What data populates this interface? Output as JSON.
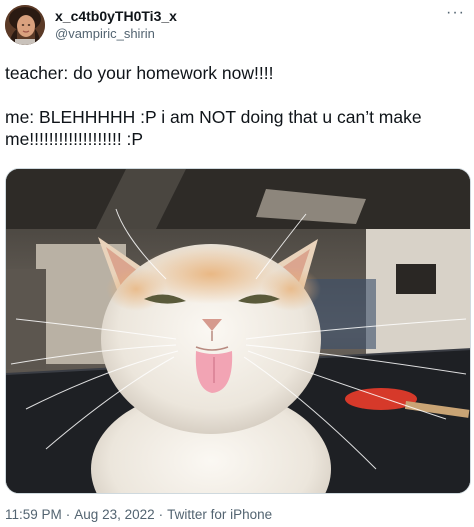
{
  "author": {
    "display_name": "x_c4tb0yTH0Ti3_x",
    "handle": "@vampiric_shirin"
  },
  "icons": {
    "more": "more-options-icon",
    "avatar": "profile-avatar"
  },
  "more_glyph": "···",
  "tweet": {
    "line1": "teacher: do your homework now!!!!",
    "line2": "me: BLEHHHHH :P i am NOT doing that u can’t make",
    "line3": "me!!!!!!!!!!!!!!!!!!! :P"
  },
  "media": {
    "kind": "photo of a white and orange cat sticking its tongue out"
  },
  "meta": {
    "time": "11:59 PM",
    "separator": "·",
    "date": "Aug 23, 2022",
    "source": "Twitter for iPhone"
  },
  "colors": {
    "text": "#0f1419",
    "secondary": "#536471",
    "border": "#cfd9de"
  }
}
